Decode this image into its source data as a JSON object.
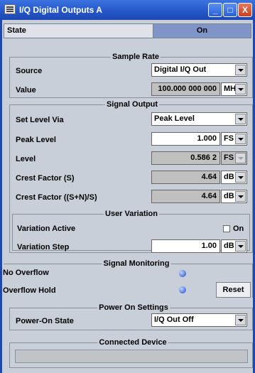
{
  "window": {
    "title": "I/Q Digital Outputs A",
    "minimize_label": "_",
    "maximize_label": "□",
    "close_label": "X"
  },
  "state": {
    "label": "State",
    "value": "On"
  },
  "sample_rate": {
    "title": "Sample Rate",
    "source_label": "Source",
    "source_value": "Digital I/Q Out",
    "value_label": "Value",
    "value": "100.000 000 000",
    "unit": "MHz"
  },
  "signal_output": {
    "title": "Signal Output",
    "set_level_via_label": "Set Level Via",
    "set_level_via_value": "Peak Level",
    "peak_level_label": "Peak Level",
    "peak_level_value": "1.000",
    "peak_level_unit": "FS",
    "level_label": "Level",
    "level_value": "0.586 2",
    "level_unit": "FS",
    "crest_s_label": "Crest Factor (S)",
    "crest_s_value": "4.64",
    "crest_s_unit": "dB",
    "crest_sn_label": "Crest Factor ((S+N)/S)",
    "crest_sn_value": "4.64",
    "crest_sn_unit": "dB",
    "user_variation": {
      "title": "User Variation",
      "variation_active_label": "Variation Active",
      "variation_active_checkbox_label": "On",
      "variation_step_label": "Variation Step",
      "variation_step_value": "1.00",
      "variation_step_unit": "dB"
    }
  },
  "signal_monitoring": {
    "title": "Signal Monitoring",
    "no_overflow_label": "No Overflow",
    "overflow_hold_label": "Overflow Hold",
    "reset_label": "Reset"
  },
  "power_on": {
    "title": "Power On Settings",
    "state_label": "Power-On State",
    "state_value": "I/Q Out Off"
  },
  "connected_device": {
    "title": "Connected Device"
  }
}
